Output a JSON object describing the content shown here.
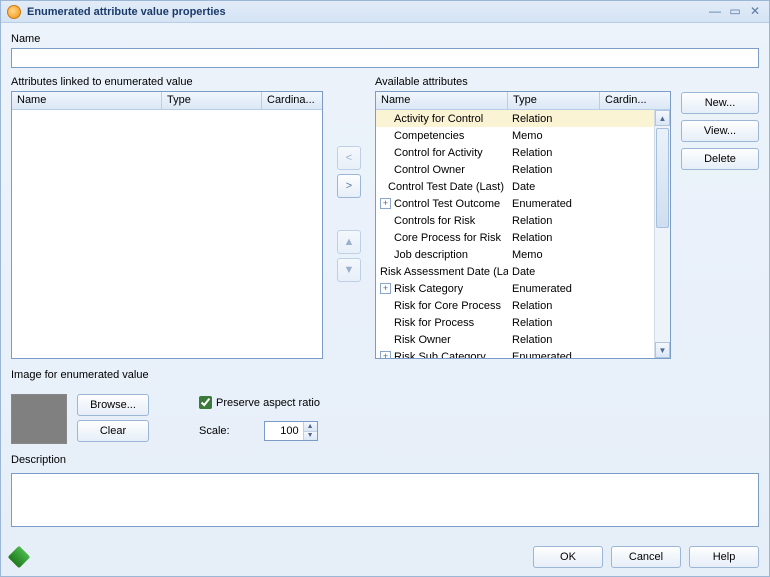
{
  "window": {
    "title": "Enumerated attribute value properties"
  },
  "name": {
    "label": "Name",
    "value": ""
  },
  "linked": {
    "title": "Attributes linked to enumerated value",
    "columns": {
      "name": "Name",
      "type": "Type",
      "cardin": "Cardina..."
    },
    "rows": []
  },
  "available": {
    "title": "Available attributes",
    "columns": {
      "name": "Name",
      "type": "Type",
      "cardin": "Cardin..."
    },
    "rows": [
      {
        "name": "Activity for Control",
        "type": "Relation",
        "expandable": false,
        "selected": true
      },
      {
        "name": "Competencies",
        "type": "Memo",
        "expandable": false
      },
      {
        "name": "Control for Activity",
        "type": "Relation",
        "expandable": false
      },
      {
        "name": "Control Owner",
        "type": "Relation",
        "expandable": false
      },
      {
        "name": "Control Test Date (Last)",
        "type": "Date",
        "expandable": false
      },
      {
        "name": "Control Test Outcome",
        "type": "Enumerated",
        "expandable": true
      },
      {
        "name": "Controls for Risk",
        "type": "Relation",
        "expandable": false
      },
      {
        "name": "Core Process for Risk",
        "type": "Relation",
        "expandable": false
      },
      {
        "name": "Job description",
        "type": "Memo",
        "expandable": false
      },
      {
        "name": "Risk Assessment Date (Last)",
        "type": "Date",
        "expandable": false,
        "truncated": "Risk Assessment Date (La"
      },
      {
        "name": "Risk Category",
        "type": "Enumerated",
        "expandable": true
      },
      {
        "name": "Risk for Core Process",
        "type": "Relation",
        "expandable": false
      },
      {
        "name": "Risk for Process",
        "type": "Relation",
        "expandable": false
      },
      {
        "name": "Risk Owner",
        "type": "Relation",
        "expandable": false
      },
      {
        "name": "Risk Sub Category",
        "type": "Enumerated",
        "expandable": true,
        "truncated": "Risk Sub Category"
      }
    ]
  },
  "actions": {
    "new": "New...",
    "view": "View...",
    "delete": "Delete"
  },
  "image": {
    "title": "Image for enumerated value",
    "browse": "Browse...",
    "clear": "Clear",
    "preserve_label": "Preserve aspect ratio",
    "preserve_checked": true,
    "scale_label": "Scale:",
    "scale_value": "100"
  },
  "description": {
    "label": "Description",
    "value": ""
  },
  "footer": {
    "ok": "OK",
    "cancel": "Cancel",
    "help": "Help"
  }
}
